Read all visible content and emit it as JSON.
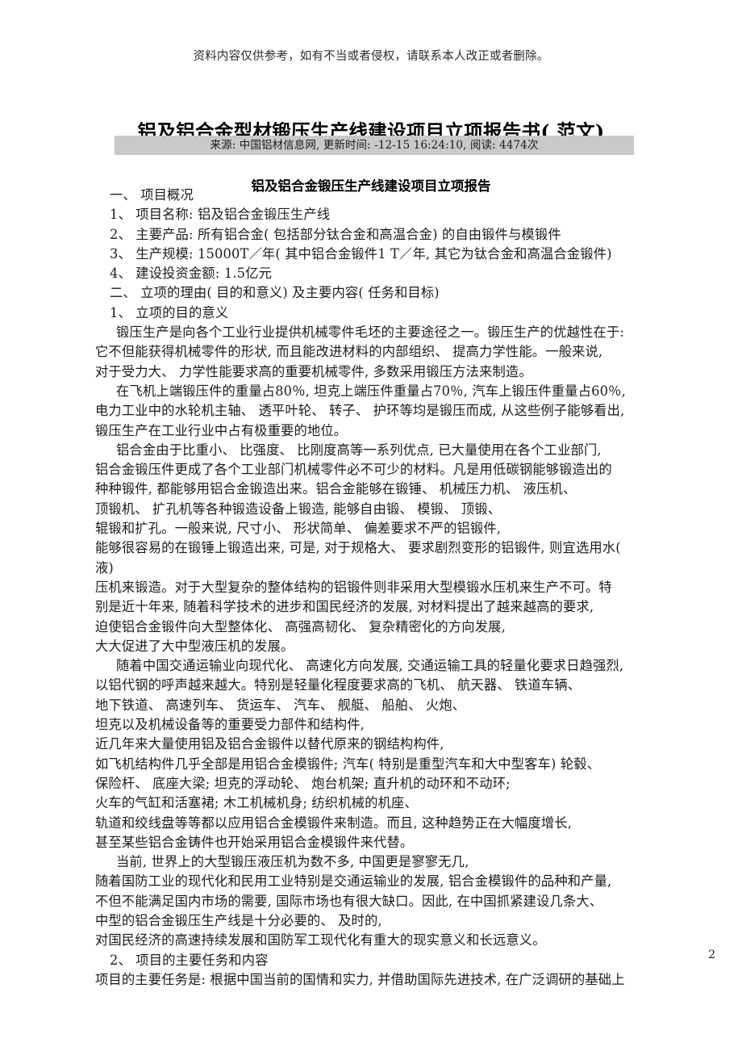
{
  "disclaimer": "资料内容仅供参考，如有不当或者侵权，请联系本人改正或者删除。",
  "doc_title": "铝及铝合金型材锻压生产线建设项目立项报告书( 范文)",
  "source_bar": "来源: 中国铝材信息网, 更新时间:  -12-15 16:24:10, 阅读:  4474次",
  "sub_title": "铝及铝合金锻压生产线建设项目立项报告",
  "page_number": "2",
  "colors": {
    "source_bar_bg": "#c9c9c9",
    "text": "#1b1b1b",
    "page_bg": "#ffffff"
  },
  "lines": [
    {
      "text": "一、 项目概况",
      "indent": "ind1"
    },
    {
      "text": "1、 项目名称: 铝及铝合金锻压生产线",
      "indent": "ind1"
    },
    {
      "text": "2、 主要产品: 所有铝合金( 包括部分钛合金和高温合金) 的自由锻件与模锻件",
      "indent": "ind1"
    },
    {
      "text": "3、 生产规模: 15000T／年( 其中铝合金锻件1 T／年, 其它为钛合金和高温合金锻件)",
      "indent": "ind1"
    },
    {
      "text": "4、 建设投资金额: 1.5亿元",
      "indent": "ind1"
    },
    {
      "text": "二、 立项的理由( 目的和意义) 及主要内容( 任务和目标)",
      "indent": "ind1"
    },
    {
      "text": "1、 立项的目的意义",
      "indent": "ind1"
    },
    {
      "text": "锻压生产是向各个工业行业提供机械零件毛坯的主要途径之一。锻压生产的优越性在于:",
      "indent": "ind-para"
    },
    {
      "text": "它不但能获得机械零件的形状, 而且能改进材料的内部组织、 提高力学性能。一般来说,",
      "indent": ""
    },
    {
      "text": "对于受力大、 力学性能要求高的重要机械零件, 多数采用锻压方法来制造。",
      "indent": ""
    },
    {
      "text": "在飞机上端锻压件的重量占80％, 坦克上端压件重量占70％, 汽车上锻压件重量占60％,",
      "indent": "ind-para"
    },
    {
      "text": "电力工业中的水轮机主轴、 透平叶轮、 转子、 护环等均是锻压而成, 从这些例子能够看出,",
      "indent": ""
    },
    {
      "text": "锻压生产在工业行业中占有极重要的地位。",
      "indent": ""
    },
    {
      "text": "铝合金由于比重小、 比强度、 比刚度高等一系列优点, 已大量使用在各个工业部门,",
      "indent": "ind-para"
    },
    {
      "text": "铝合金锻压件更成了各个工业部门机械零件必不可少的材料。凡是用低碳钢能够锻造出的",
      "indent": ""
    },
    {
      "text": "种种锻件, 都能够用铝合金锻造出来。铝合金能够在锻锤、 机械压力机、 液压机、",
      "indent": ""
    },
    {
      "text": "顶锻机、 扩孔机等各种锻造设备上锻造, 能够自由锻、 模锻、 顶锻、",
      "indent": ""
    },
    {
      "text": "辊锻和扩孔。一般来说, 尺寸小、 形状简单、 偏差要求不严的铝锻件,",
      "indent": ""
    },
    {
      "text": "能够很容易的在锻锤上锻造出来, 可是, 对于规格大、 要求剧烈变形的铝锻件, 则宜选用水(",
      "indent": ""
    },
    {
      "text": "液)",
      "indent": ""
    },
    {
      "text": "压机来锻造。对于大型复杂的整体结构的铝锻件则非采用大型模锻水压机来生产不可。特",
      "indent": ""
    },
    {
      "text": "别是近十年来, 随着科学技术的进步和国民经济的发展, 对材料提出了越来越高的要求,",
      "indent": ""
    },
    {
      "text": "迫使铝合金锻件向大型整体化、 高强高韧化、 复杂精密化的方向发展,",
      "indent": ""
    },
    {
      "text": "大大促进了大中型液压机的发展。",
      "indent": ""
    },
    {
      "text": "随着中国交通运输业向现代化、 高速化方向发展, 交通运输工具的轻量化要求日趋强烈,",
      "indent": "ind-para"
    },
    {
      "text": "以铝代钢的呼声越来越大。特别是轻量化程度要求高的飞机、 航天器、 铁道车辆、",
      "indent": ""
    },
    {
      "text": "地下铁道、 高速列车、 货运车、 汽车、 舰艇、 船舶、 火炮、",
      "indent": ""
    },
    {
      "text": "坦克以及机械设备等的重要受力部件和结构件,",
      "indent": ""
    },
    {
      "text": "近几年来大量使用铝及铝合金锻件以替代原来的钢结构构件,",
      "indent": ""
    },
    {
      "text": "如飞机结构件几乎全部是用铝合金模锻件; 汽车( 特别是重型汽车和大中型客车) 轮毂、",
      "indent": ""
    },
    {
      "text": "保险杆、 底座大梁; 坦克的浮动轮、 炮台机架; 直升机的动环和不动环;",
      "indent": ""
    },
    {
      "text": "火车的气缸和活塞裙; 木工机械机身; 纺织机械的机座、",
      "indent": ""
    },
    {
      "text": "轨道和绞线盘等等都以应用铝合金模锻件来制造。而且, 这种趋势正在大幅度增长,",
      "indent": ""
    },
    {
      "text": "甚至某些铝合金铸件也开始采用铝合金模锻件来代替。",
      "indent": ""
    },
    {
      "text": "当前, 世界上的大型锻压液压机为数不多, 中国更是寥寥无几,",
      "indent": "ind-para"
    },
    {
      "text": "随着国防工业的现代化和民用工业特别是交通运输业的发展, 铝合金模锻件的品种和产量,",
      "indent": ""
    },
    {
      "text": "不但不能满足国内市场的需要, 国际市场也有很大缺口。因此, 在中国抓紧建设几条大、",
      "indent": ""
    },
    {
      "text": "中型的铝合金锻压生产线是十分必要的、 及时的,",
      "indent": ""
    },
    {
      "text": "对国民经济的高速持续发展和国防军工现代化有重大的现实意义和长远意义。",
      "indent": ""
    },
    {
      "text": "2、 项目的主要任务和内容",
      "indent": "ind1"
    },
    {
      "text": "项目的主要任务是: 根据中国当前的国情和实力, 并借助国际先进技术, 在广泛调研的基础上",
      "indent": ""
    }
  ]
}
